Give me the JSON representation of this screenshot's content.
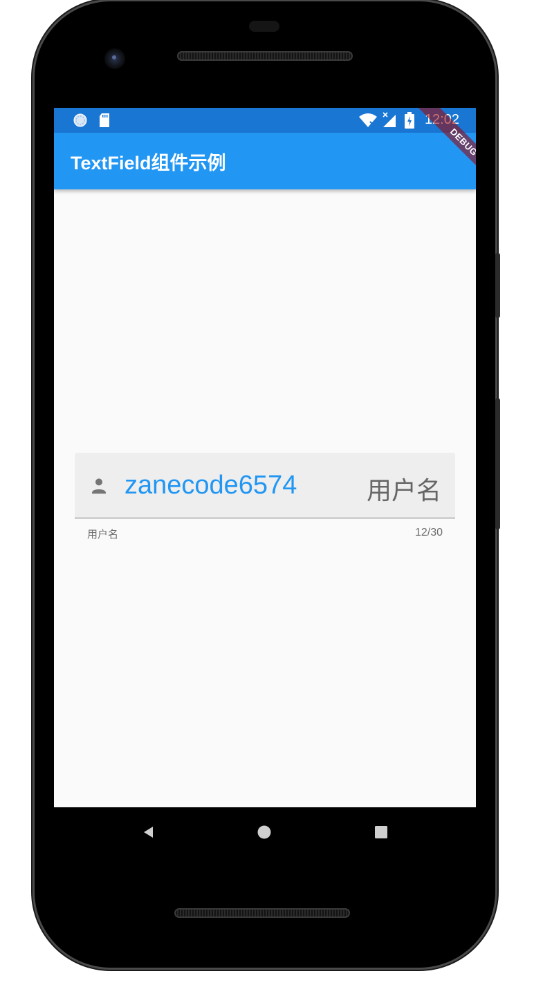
{
  "status_bar": {
    "time": "12:02",
    "left_icons": [
      "sync-circle-icon",
      "sd-card-icon"
    ],
    "right_icons": [
      "wifi-icon",
      "signal-icon",
      "battery-icon"
    ]
  },
  "app_bar": {
    "title": "TextField组件示例",
    "color": "#2196f3",
    "status_color": "#1976d2"
  },
  "debug_banner": {
    "label": "DEBUG"
  },
  "text_field": {
    "prefix_icon": "person-icon",
    "value": "zanecode6574",
    "suffix_text": "用户名",
    "helper_text": "用户名",
    "counter": "12/30",
    "accent_color": "#2196f3"
  },
  "nav_bar": {
    "buttons": [
      "back-icon",
      "home-icon",
      "recents-icon"
    ]
  }
}
